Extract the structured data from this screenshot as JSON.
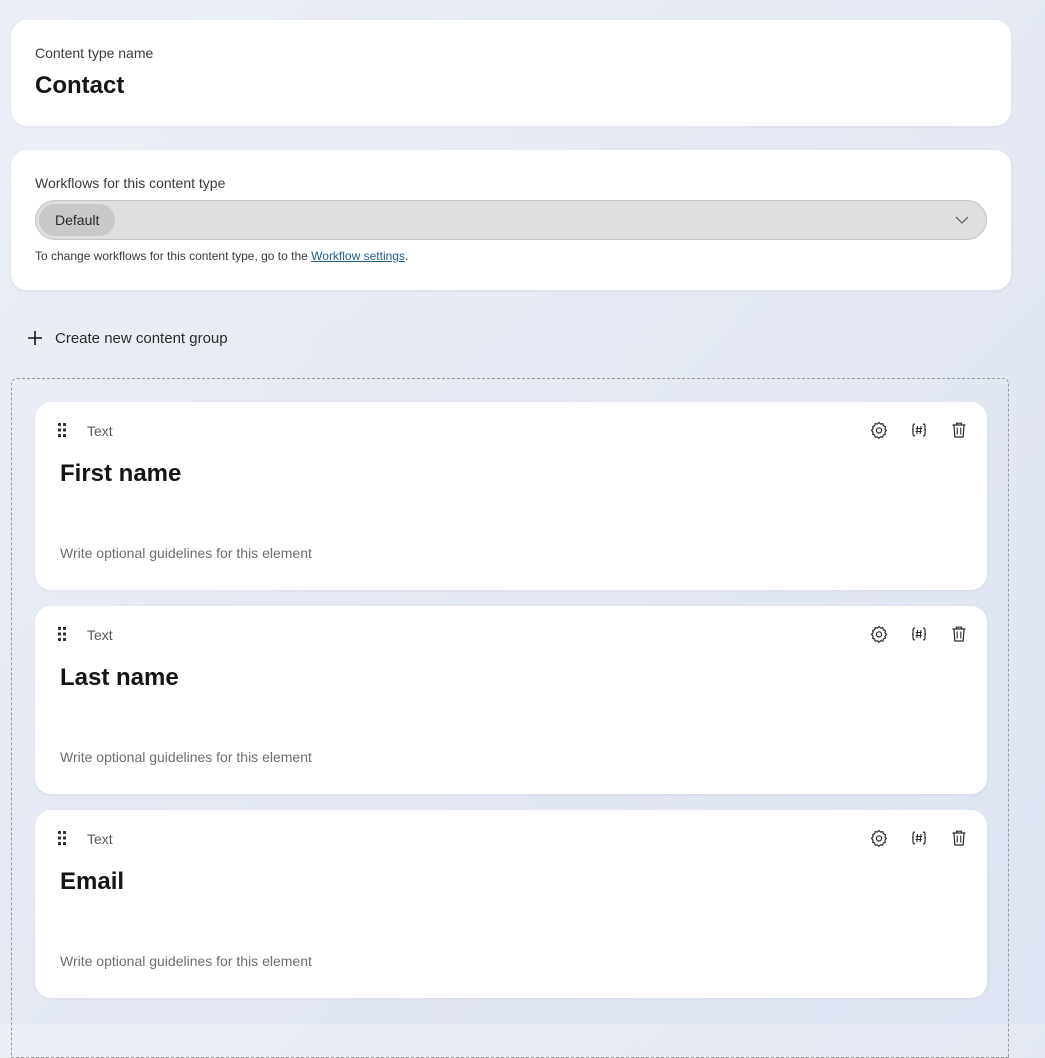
{
  "content_type": {
    "label": "Content type name",
    "value": "Contact"
  },
  "workflows": {
    "label": "Workflows for this content type",
    "selected": "Default",
    "hint_prefix": "To change workflows for this content type, go to the ",
    "hint_link": "Workflow settings",
    "hint_suffix": "."
  },
  "create_group": {
    "label": "Create new content group",
    "icon": "plus-icon"
  },
  "elements": [
    {
      "type": "Text",
      "name": "First name",
      "guidelines_placeholder": "Write optional guidelines for this element"
    },
    {
      "type": "Text",
      "name": "Last name",
      "guidelines_placeholder": "Write optional guidelines for this element"
    },
    {
      "type": "Text",
      "name": "Email",
      "guidelines_placeholder": "Write optional guidelines for this element"
    }
  ],
  "element_actions": [
    "gear-icon",
    "codename-icon",
    "trash-icon"
  ],
  "colors": {
    "link": "#1e5f8e",
    "select_background": "#dedede",
    "chip_background": "#c9c9c9"
  }
}
